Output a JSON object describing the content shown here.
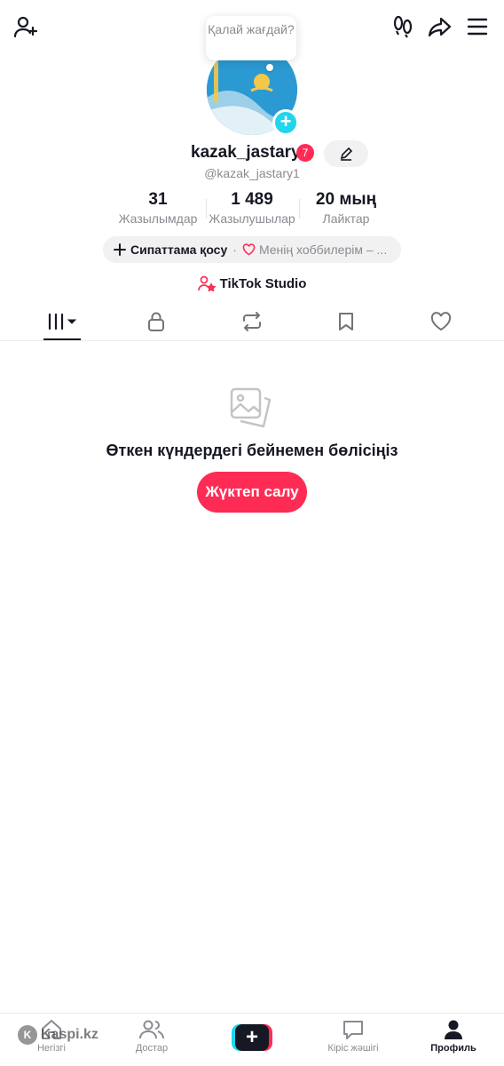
{
  "header": {
    "status_bubble": "Қалай жағдай?"
  },
  "profile": {
    "username": "kazak_jastary",
    "notification_count": "7",
    "handle": "@kazak_jastary1",
    "stats": [
      {
        "value": "31",
        "label": "Жазылымдар"
      },
      {
        "value": "1 489",
        "label": "Жазылушылар"
      },
      {
        "value": "20 мың",
        "label": "Лайктар"
      }
    ],
    "bio_add": "Сипаттама қосу",
    "bio_separator": "·",
    "hobbies": "Менің хоббилерім – ...",
    "studio_label": "TikTok Studio"
  },
  "tabs": [
    {
      "icon": "grid-icon",
      "active": true
    },
    {
      "icon": "lock-icon"
    },
    {
      "icon": "repost-icon"
    },
    {
      "icon": "bookmark-icon"
    },
    {
      "icon": "heart-icon"
    }
  ],
  "empty_state": {
    "title": "Өткен күндердегі бейнемен бөлісіңіз",
    "button": "Жүктеп салу"
  },
  "bottom_nav": {
    "home": "Негізгі",
    "friends": "Достар",
    "inbox": "Кіріс жәшігі",
    "profile": "Профиль"
  },
  "watermark": "Kaspi.kz",
  "colors": {
    "accent": "#fe2c55",
    "cyan": "#20d5ec",
    "text": "#161823",
    "muted": "#8a8b91"
  }
}
